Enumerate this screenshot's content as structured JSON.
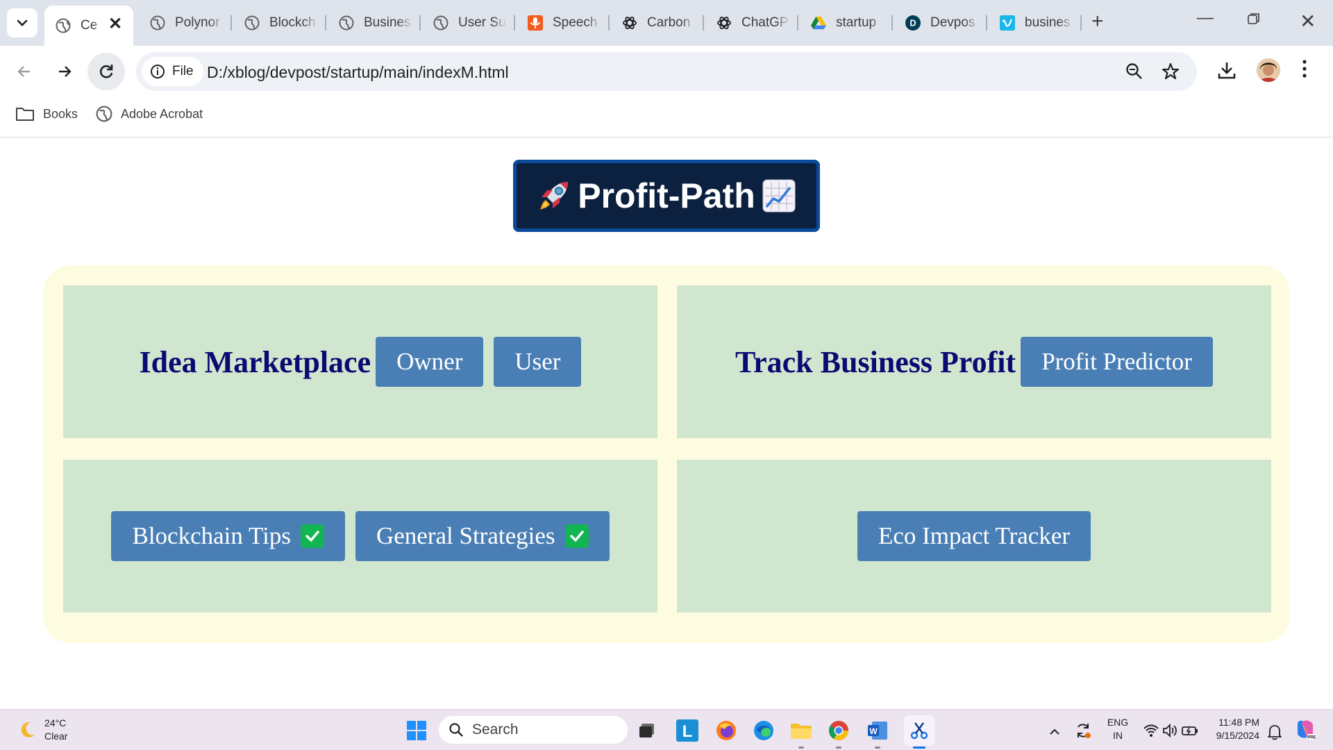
{
  "browser": {
    "tabs": [
      {
        "title": "Ce",
        "icon": "globe-icon",
        "active": true
      },
      {
        "title": "Polynor",
        "icon": "globe-icon"
      },
      {
        "title": "Blockch",
        "icon": "globe-icon"
      },
      {
        "title": "Busines",
        "icon": "globe-icon"
      },
      {
        "title": "User Su",
        "icon": "globe-icon"
      },
      {
        "title": "Speech",
        "icon": "microphone-icon"
      },
      {
        "title": "Carbon",
        "icon": "chatgpt-icon"
      },
      {
        "title": "ChatGP",
        "icon": "chatgpt-icon"
      },
      {
        "title": "startup",
        "icon": "google-drive-icon"
      },
      {
        "title": "Devpos",
        "icon": "devpost-icon"
      },
      {
        "title": "busines",
        "icon": "vimeo-icon"
      }
    ],
    "site_chip": "File",
    "url": "D:/xblog/devpost/startup/main/indexM.html",
    "bookmarks": [
      {
        "label": "Books",
        "icon": "folder-icon"
      },
      {
        "label": "Adobe Acrobat",
        "icon": "globe-icon"
      }
    ]
  },
  "page": {
    "brand": {
      "title": "Profit-Path",
      "left_emoji": "rocket",
      "right_emoji": "chart-increasing"
    },
    "cells": {
      "idea_title": "Idea Marketplace",
      "owner_button": "Owner",
      "user_button": "User",
      "track_title": "Track Business Profit",
      "predictor_button": "Profit Predictor",
      "blockchain_button": "Blockchain Tips",
      "strategies_button": "General Strategies",
      "eco_button": "Eco Impact Tracker"
    }
  },
  "taskbar": {
    "weather_temp": "24°C",
    "weather_desc": "Clear",
    "search_placeholder": "Search",
    "lang_top": "ENG",
    "lang_bottom": "IN",
    "time": "11:48 PM",
    "date": "9/15/2024"
  },
  "colors": {
    "brand_bg": "#0c2140",
    "brand_border": "#0a4a9c",
    "panel_bg": "#fefce0",
    "cell_bg": "#d0e6cf",
    "button_bg": "#4a7fb5",
    "title_text": "#0a0a73",
    "check_green": "#12b552"
  }
}
